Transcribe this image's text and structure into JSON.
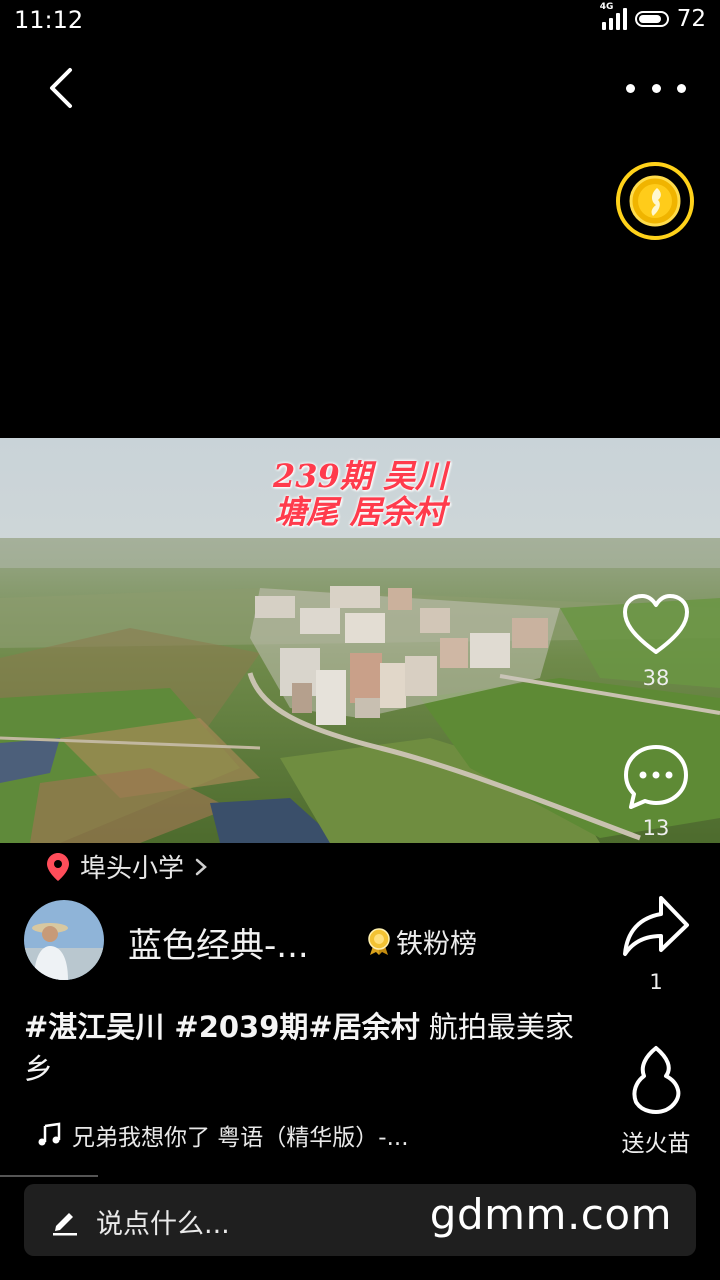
{
  "status_bar": {
    "time": "11:12",
    "network": "4G",
    "battery": "72"
  },
  "video": {
    "overlay_line1": "239期 吴川",
    "overlay_line2": "塘尾 居余村"
  },
  "actions": {
    "likes": "38",
    "comments": "13",
    "shares": "1",
    "fire_label": "送火苗"
  },
  "location": {
    "name": "埠头小学"
  },
  "author": {
    "name": "蓝色经典-...",
    "badge": "铁粉榜"
  },
  "caption": {
    "tags": "#湛江吴川 #2039期#居余村",
    "text": " 航拍最美家乡"
  },
  "music": {
    "title": "兄弟我想你了 粤语（精华版）-..."
  },
  "comment": {
    "placeholder": "说点什么...",
    "watermark": "gdmm.com"
  }
}
